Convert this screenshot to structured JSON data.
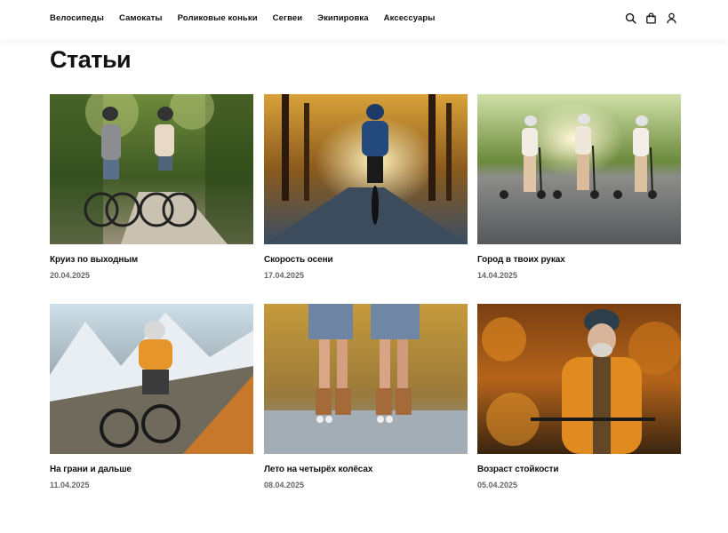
{
  "nav": {
    "items": [
      "Велосипеды",
      "Самокаты",
      "Роликовые коньки",
      "Сегвеи",
      "Экипировка",
      "Аксессуары"
    ]
  },
  "icons": [
    "search-icon",
    "bag-icon",
    "user-icon"
  ],
  "page": {
    "title": "Статьи"
  },
  "articles": [
    {
      "title": "Круиз по выходным",
      "date": "20.04.2025",
      "image": "couple-cycling-forest-photo"
    },
    {
      "title": "Скорость осени",
      "date": "17.04.2025",
      "image": "cyclist-autumn-road-photo"
    },
    {
      "title": "Город в твоих руках",
      "date": "14.04.2025",
      "image": "scooter-riders-sunset-photo"
    },
    {
      "title": "На грани и дальше",
      "date": "11.04.2025",
      "image": "mountain-biker-photo"
    },
    {
      "title": "Лето на четырёх колёсах",
      "date": "08.04.2025",
      "image": "roller-skates-legs-photo"
    },
    {
      "title": "Возраст стойкости",
      "date": "05.04.2025",
      "image": "senior-cyclist-autumn-photo"
    }
  ]
}
